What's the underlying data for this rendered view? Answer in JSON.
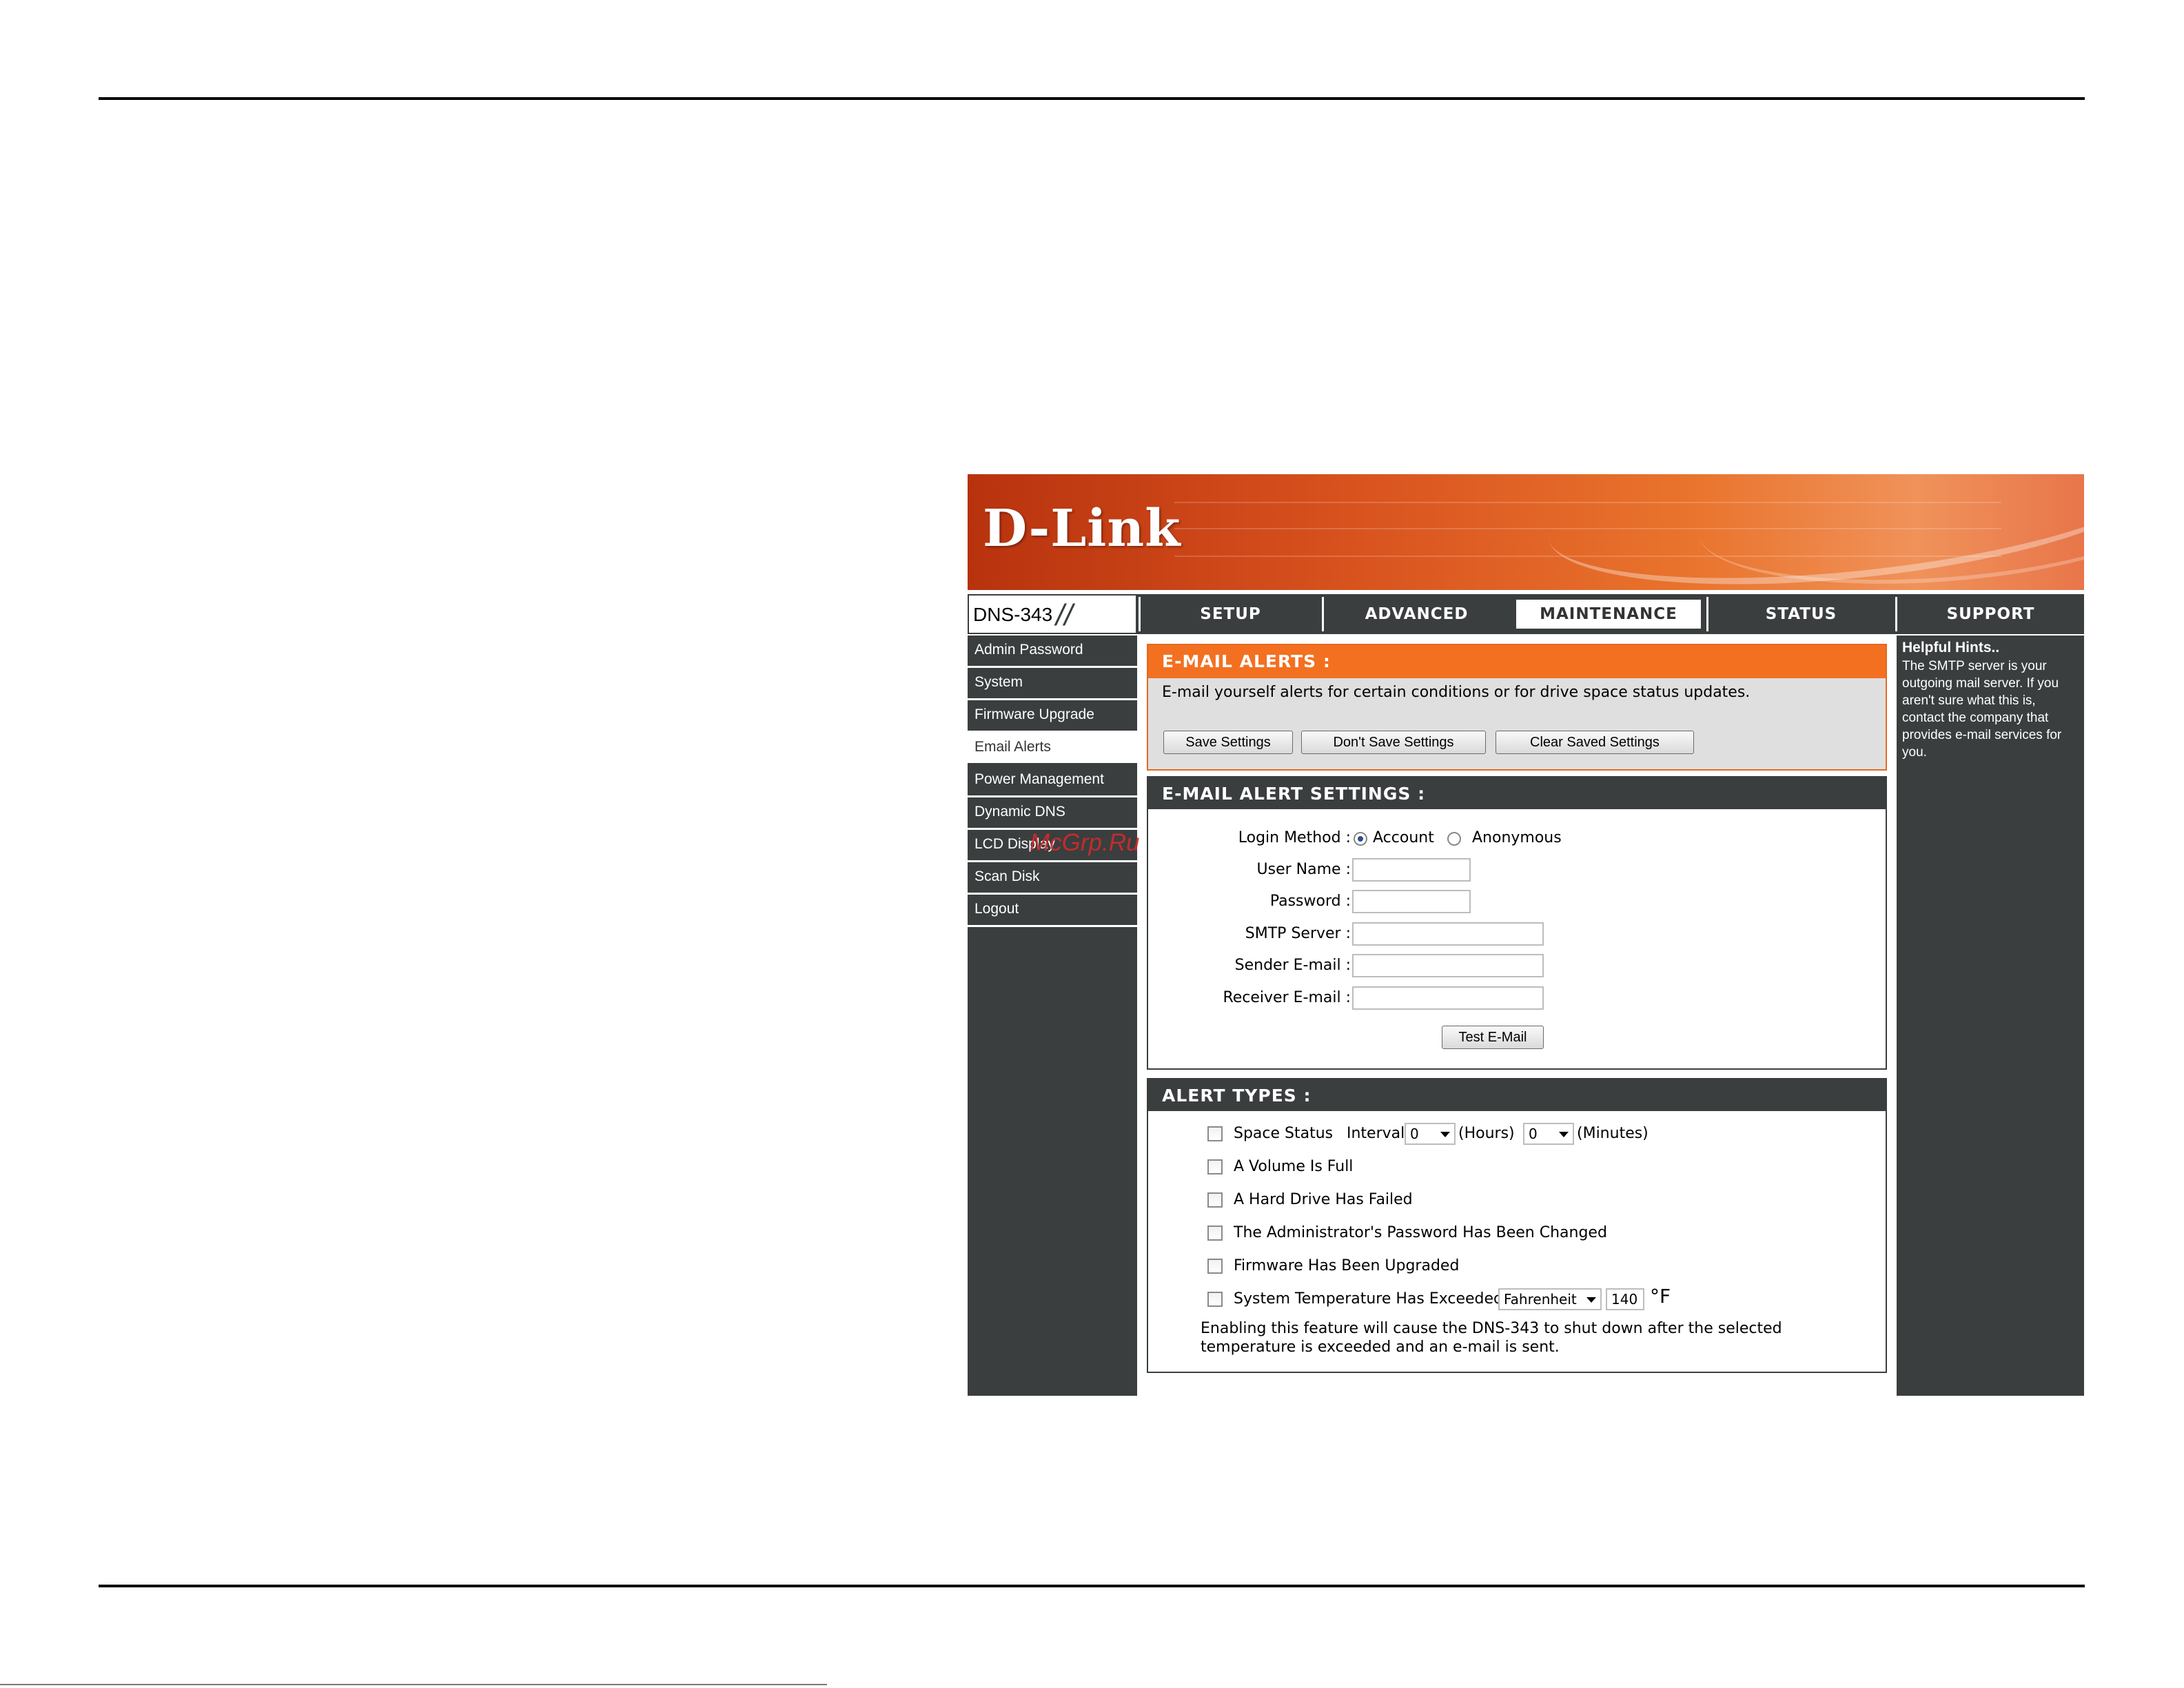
{
  "banner": {
    "logo": "D-Link"
  },
  "nav": {
    "model": "DNS-343",
    "tabs": [
      "SETUP",
      "ADVANCED",
      "MAINTENANCE",
      "STATUS",
      "SUPPORT"
    ],
    "active_tab": "MAINTENANCE"
  },
  "sidebar": {
    "items": [
      "Admin Password",
      "System",
      "Firmware Upgrade",
      "Email Alerts",
      "Power Management",
      "Dynamic DNS",
      "LCD Display",
      "Scan Disk",
      "Logout"
    ],
    "active": "Email Alerts"
  },
  "email_alerts": {
    "title": "E-MAIL ALERTS :",
    "description": "E-mail yourself alerts for certain conditions or for drive space status updates.",
    "buttons": {
      "save": "Save Settings",
      "dont_save": "Don't Save Settings",
      "clear": "Clear Saved Settings"
    }
  },
  "alert_settings": {
    "title": "E-MAIL ALERT SETTINGS :",
    "login_method_label": "Login Method :",
    "login_options": {
      "account": "Account",
      "anonymous": "Anonymous"
    },
    "login_selected": "Account",
    "user_name_label": "User Name :",
    "password_label": "Password :",
    "smtp_label": "SMTP Server :",
    "sender_label": "Sender E-mail :",
    "receiver_label": "Receiver E-mail :",
    "user_name": "",
    "password": "",
    "smtp_server": "",
    "sender_email": "",
    "receiver_email": "",
    "test_button": "Test E-Mail"
  },
  "alert_types": {
    "title": "ALERT TYPES :",
    "space_status": "Space Status",
    "interval_label": "Interval:",
    "hours_value": "0",
    "hours_label": "(Hours)",
    "minutes_value": "0",
    "minutes_label": "(Minutes)",
    "volume_full": "A Volume Is Full",
    "drive_failed": "A Hard Drive Has Failed",
    "password_changed": "The Administrator's Password Has Been Changed",
    "firmware_upgraded": "Firmware Has Been Upgraded",
    "temp_exceeded": "System Temperature Has Exceeded",
    "temp_unit_select": "Fahrenheit",
    "temp_value": "140",
    "temp_unit": "°F",
    "note": "Enabling this feature will cause the DNS-343 to shut down after the selected temperature is exceeded and an e-mail is sent."
  },
  "hints": {
    "title": "Helpful Hints..",
    "text": "The SMTP server is your outgoing mail server. If you aren't sure what this is, contact the company that provides e-mail services for you."
  },
  "watermark": "McGrp.Ru",
  "colors": {
    "orange": "#f37021",
    "dark": "#3a3e3f",
    "panel_bg": "#dfdfdf"
  }
}
